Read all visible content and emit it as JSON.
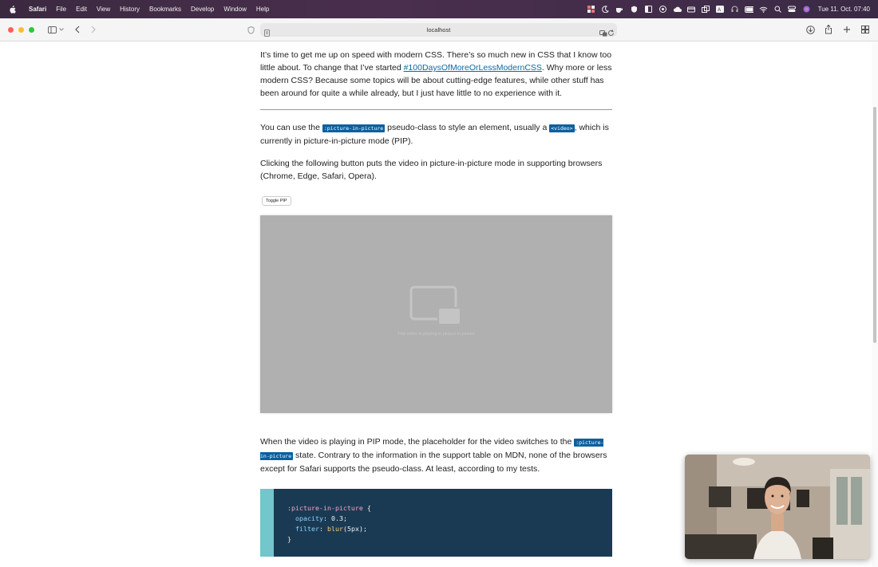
{
  "menubar": {
    "app_name": "Safari",
    "items": [
      "File",
      "Edit",
      "View",
      "History",
      "Bookmarks",
      "Develop",
      "Window",
      "Help"
    ],
    "clock": "Tue 11. Oct. 07:40"
  },
  "toolbar": {
    "url": "localhost"
  },
  "content": {
    "intro": {
      "text_before": "It’s time to get me up on speed with modern CSS. There’s so much new in CSS that I know too little about. To change that I’ve started ",
      "link": "#100DaysOfMoreOrLessModernCSS",
      "text_after": ". Why more or less modern CSS? Because some topics will be about cutting-edge features, while other stuff has been around for quite a while already, but I just have little to no experience with it."
    },
    "para2": {
      "before": "You can use the ",
      "code1": ":picture-in-picture",
      "middle": " pseudo-class to style an element, usually a ",
      "code2": "<video>",
      "after": ", which is currently in picture-in-picture mode (PIP)."
    },
    "para3": "Clicking the following button puts the video in picture-in-picture mode in supporting browsers (Chrome, Edge, Safari, Opera).",
    "toggle_button": "Toggle PIP",
    "video_caption": "This video is playing in picture in picture",
    "para4": {
      "before": "When the video is playing in PIP mode, the placeholder for the video switches to the ",
      "code": ":picture-in-picture",
      "after": " state. Contrary to the information in the support table on MDN, none of the browsers except for Safari supports the pseudo-class. At least, according to my tests."
    },
    "code": {
      "selector": ":picture-in-picture",
      "open": " {",
      "prop1": "opacity",
      "val1": "0.3",
      "prop2": "filter",
      "fn2": "blur",
      "arg2": "5px",
      "close": "}"
    }
  }
}
